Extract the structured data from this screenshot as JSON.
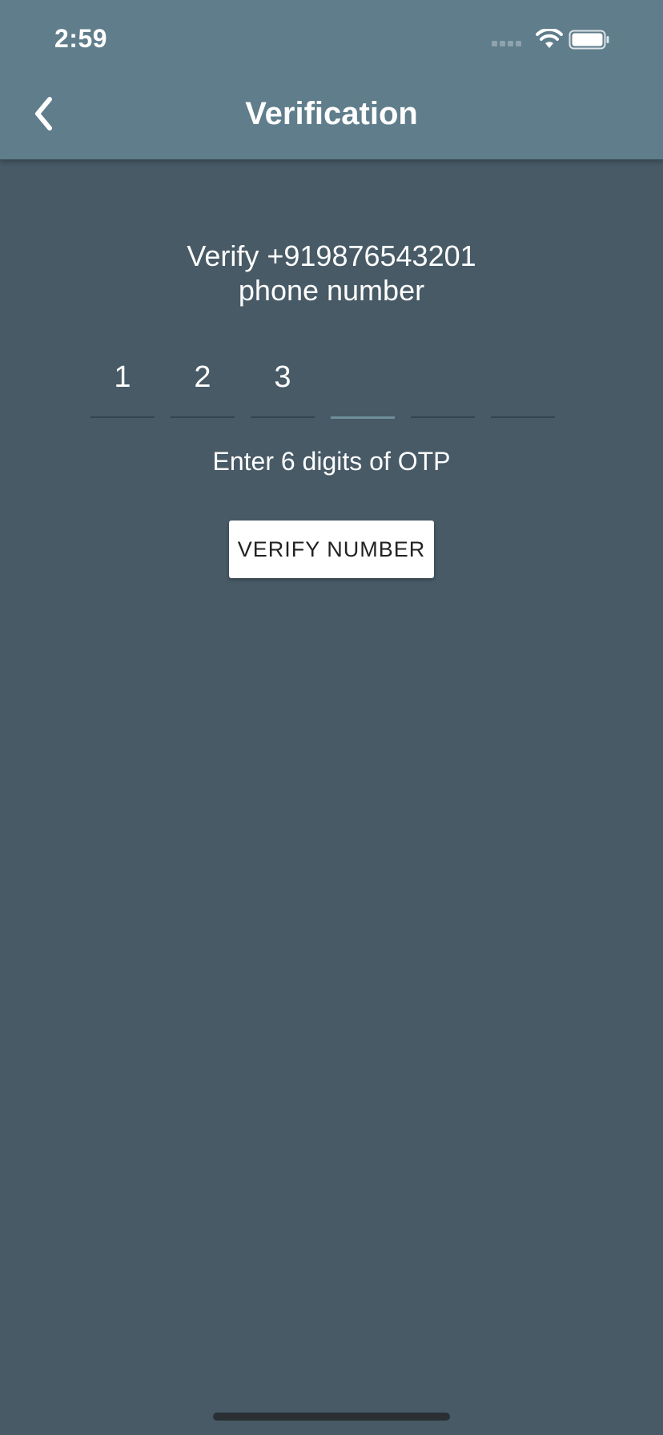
{
  "status_bar": {
    "time": "2:59",
    "icons": [
      "signal-dots-icon",
      "wifi-icon",
      "battery-icon"
    ]
  },
  "app_bar": {
    "back_icon": "chevron-left-icon",
    "title": "Verification"
  },
  "main": {
    "heading_line1": "Verify +919876543201",
    "heading_line2": "phone number",
    "otp_digits": [
      "1",
      "2",
      "3",
      "",
      "",
      ""
    ],
    "active_index": 3,
    "hint": "Enter 6 digits of OTP",
    "verify_label": "VERIFY NUMBER"
  },
  "colors": {
    "background": "#475a66",
    "app_bar": "#5f7d8b",
    "otp_underline": "#34444e",
    "otp_active_underline": "#6e8f9c",
    "button_bg": "#ffffff",
    "button_text": "#222222"
  }
}
